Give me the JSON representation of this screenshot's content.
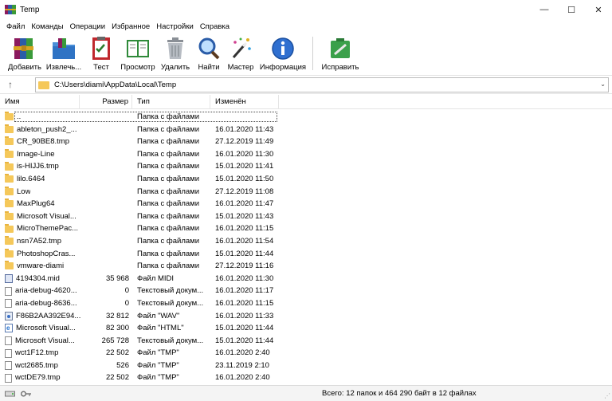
{
  "window": {
    "title": "Temp",
    "minimize_glyph": "—",
    "maximize_glyph": "☐",
    "close_glyph": "✕"
  },
  "menu": [
    "Файл",
    "Команды",
    "Операции",
    "Избранное",
    "Настройки",
    "Справка"
  ],
  "toolbar": {
    "buttons": [
      {
        "label": "Добавить",
        "icon": "archive-books-icon"
      },
      {
        "label": "Извлечь...",
        "icon": "extract-folder-icon"
      },
      {
        "label": "Тест",
        "icon": "test-checklist-icon"
      },
      {
        "label": "Просмотр",
        "icon": "view-book-icon"
      },
      {
        "label": "Удалить",
        "icon": "trash-icon"
      },
      {
        "label": "Найти",
        "icon": "magnifier-icon"
      },
      {
        "label": "Мастер",
        "icon": "wizard-wand-icon"
      },
      {
        "label": "Информация",
        "icon": "info-icon"
      },
      {
        "label": "Исправить",
        "icon": "repair-kit-icon"
      }
    ]
  },
  "address": {
    "up_glyph": "↑",
    "path": "C:\\Users\\diami\\AppData\\Local\\Temp",
    "dropdown_glyph": "⌄"
  },
  "columns": {
    "name": "Имя",
    "size": "Размер",
    "type": "Тип",
    "modified": "Изменён"
  },
  "files": [
    {
      "name": "..",
      "size": "",
      "type": "Папка с файлами",
      "modified": "",
      "icon": "folder"
    },
    {
      "name": "ableton_push2_...",
      "size": "",
      "type": "Папка с файлами",
      "modified": "16.01.2020 11:43",
      "icon": "folder"
    },
    {
      "name": "CR_90BE8.tmp",
      "size": "",
      "type": "Папка с файлами",
      "modified": "27.12.2019 11:49",
      "icon": "folder"
    },
    {
      "name": "Image-Line",
      "size": "",
      "type": "Папка с файлами",
      "modified": "16.01.2020 11:30",
      "icon": "folder"
    },
    {
      "name": "is-HIJJ6.tmp",
      "size": "",
      "type": "Папка с файлами",
      "modified": "15.01.2020 11:41",
      "icon": "folder"
    },
    {
      "name": "lilo.6464",
      "size": "",
      "type": "Папка с файлами",
      "modified": "15.01.2020 11:50",
      "icon": "folder"
    },
    {
      "name": "Low",
      "size": "",
      "type": "Папка с файлами",
      "modified": "27.12.2019 11:08",
      "icon": "folder"
    },
    {
      "name": "MaxPlug64",
      "size": "",
      "type": "Папка с файлами",
      "modified": "16.01.2020 11:47",
      "icon": "folder"
    },
    {
      "name": "Microsoft Visual...",
      "size": "",
      "type": "Папка с файлами",
      "modified": "15.01.2020 11:43",
      "icon": "folder"
    },
    {
      "name": "MicroThemePac...",
      "size": "",
      "type": "Папка с файлами",
      "modified": "16.01.2020 11:15",
      "icon": "folder"
    },
    {
      "name": "nsn7A52.tmp",
      "size": "",
      "type": "Папка с файлами",
      "modified": "16.01.2020 11:54",
      "icon": "folder"
    },
    {
      "name": "PhotoshopCras...",
      "size": "",
      "type": "Папка с файлами",
      "modified": "15.01.2020 11:44",
      "icon": "folder"
    },
    {
      "name": "vmware-diami",
      "size": "",
      "type": "Папка с файлами",
      "modified": "27.12.2019 11:16",
      "icon": "folder"
    },
    {
      "name": "4194304.mid",
      "size": "35 968",
      "type": "Файл MIDI",
      "modified": "16.01.2020 11:30",
      "icon": "midi"
    },
    {
      "name": "aria-debug-4620...",
      "size": "0",
      "type": "Текстовый докум...",
      "modified": "16.01.2020 11:17",
      "icon": "file"
    },
    {
      "name": "aria-debug-8636...",
      "size": "0",
      "type": "Текстовый докум...",
      "modified": "16.01.2020 11:15",
      "icon": "file"
    },
    {
      "name": "F86B2AA392E94...",
      "size": "32 812",
      "type": "Файл \"WAV\"",
      "modified": "16.01.2020 11:33",
      "icon": "wav"
    },
    {
      "name": "Microsoft Visual...",
      "size": "82 300",
      "type": "Файл \"HTML\"",
      "modified": "15.01.2020 11:44",
      "icon": "html"
    },
    {
      "name": "Microsoft Visual...",
      "size": "265 728",
      "type": "Текстовый докум...",
      "modified": "15.01.2020 11:44",
      "icon": "file"
    },
    {
      "name": "wct1F12.tmp",
      "size": "22 502",
      "type": "Файл \"TMP\"",
      "modified": "16.01.2020 2:40",
      "icon": "file"
    },
    {
      "name": "wct2685.tmp",
      "size": "526",
      "type": "Файл \"TMP\"",
      "modified": "23.11.2019 2:10",
      "icon": "file"
    },
    {
      "name": "wctDE79.tmp",
      "size": "22 502",
      "type": "Файл \"TMP\"",
      "modified": "16.01.2020 2:40",
      "icon": "file"
    }
  ],
  "status": {
    "text": "Всего: 12 папок и 464 290 байт в 12 файлах",
    "grip_glyph": "⋰"
  }
}
